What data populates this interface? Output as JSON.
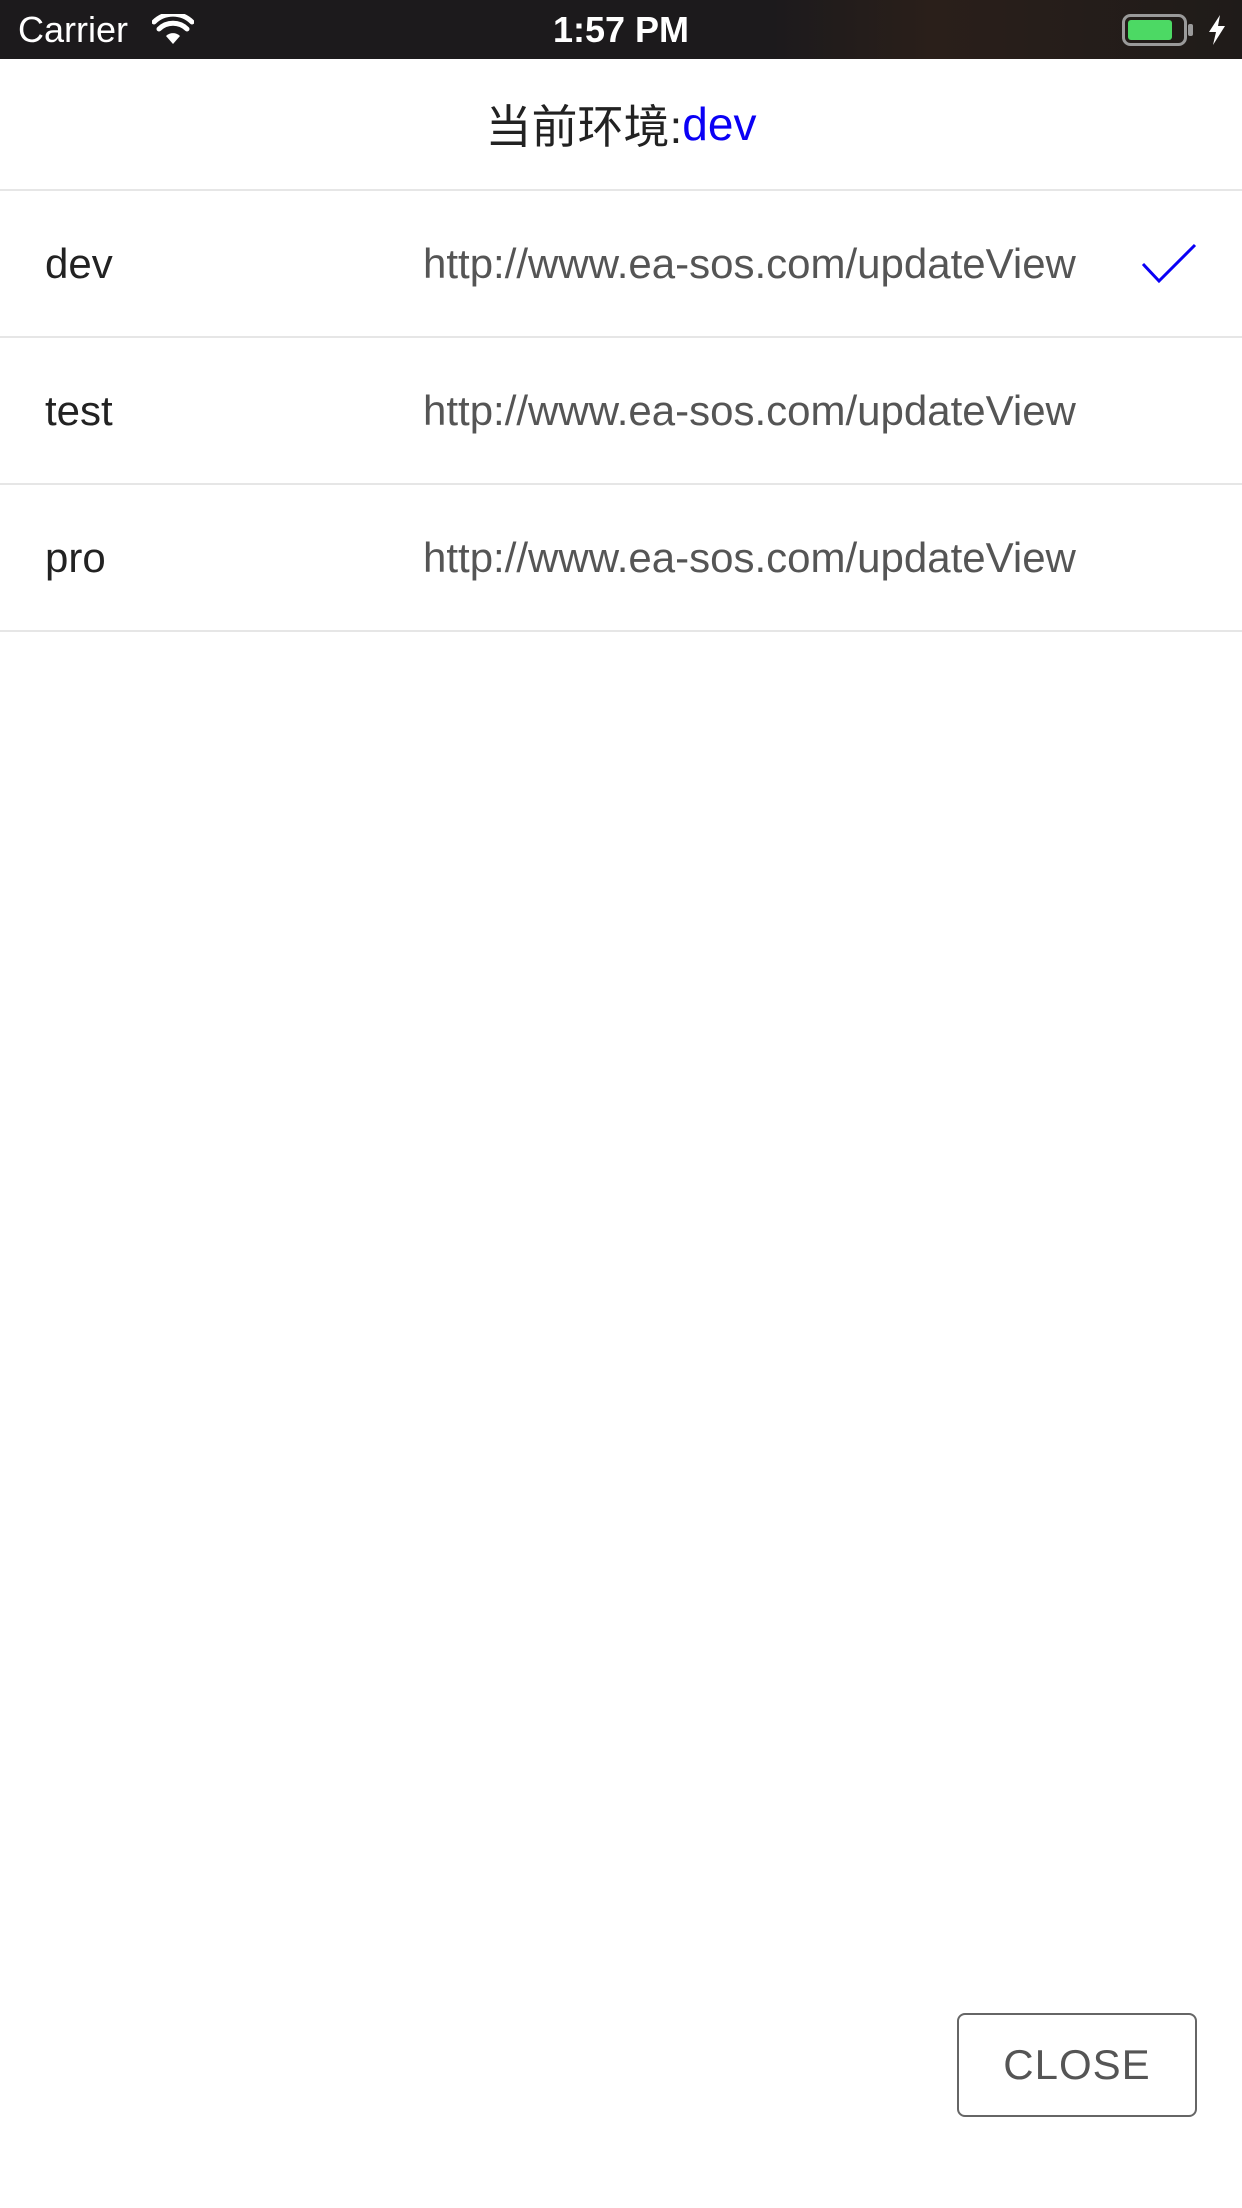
{
  "status_bar": {
    "carrier": "Carrier",
    "time": "1:57 PM",
    "icons": [
      "wifi-icon",
      "battery-icon",
      "charging-bolt-icon"
    ],
    "battery_color": "#4cd964"
  },
  "header": {
    "label": "当前环境: ",
    "current_env": "dev",
    "accent_color": "#0a00f5"
  },
  "environments": [
    {
      "name": "dev",
      "url": "http://www.ea-sos.com/updateView",
      "selected": true
    },
    {
      "name": "test",
      "url": "http://www.ea-sos.com/updateView",
      "selected": false
    },
    {
      "name": "pro",
      "url": "http://www.ea-sos.com/updateView",
      "selected": false
    }
  ],
  "close_button": {
    "label": "CLOSE"
  }
}
